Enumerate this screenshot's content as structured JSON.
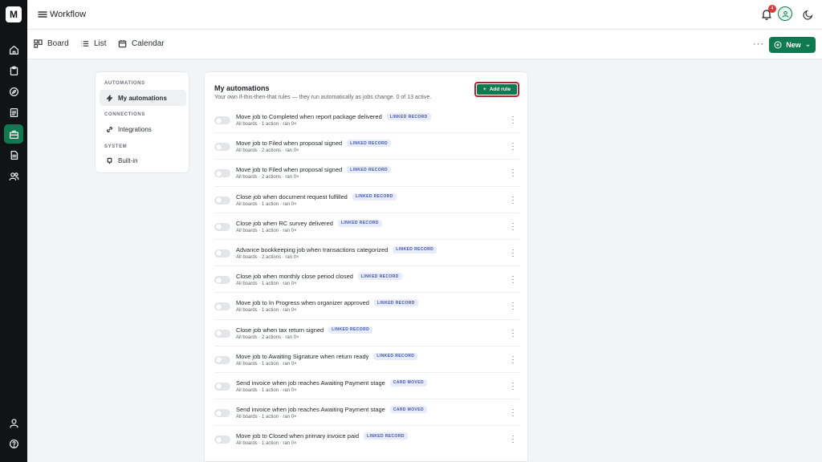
{
  "rail": {
    "logo": "M",
    "items": [
      "home",
      "clipboard",
      "compass",
      "document",
      "briefcase",
      "file",
      "users"
    ],
    "bottom": [
      "user",
      "help"
    ]
  },
  "topbar": {
    "title": "Workflow",
    "notifications": "4"
  },
  "viewbar": {
    "tabs": [
      {
        "label": "Board",
        "icon": "board-icon"
      },
      {
        "label": "List",
        "icon": "list-icon"
      },
      {
        "label": "Calendar",
        "icon": "calendar-icon"
      }
    ],
    "more": "···",
    "new_label": "New"
  },
  "sidenav": {
    "automations_heading": "AUTOMATIONS",
    "my_automations": "My automations",
    "connections_heading": "CONNECTIONS",
    "integrations": "Integrations",
    "system_heading": "SYSTEM",
    "builtin": "Built-in"
  },
  "main": {
    "title": "My automations",
    "subtitle": "Your own if-this-then-that rules — they run automatically as jobs change. 0 of 13 active.",
    "add_rule": "Add rule",
    "rules": [
      {
        "name": "Move job to Completed when report package delivered",
        "tag": "LINKED RECORD",
        "meta": "All boards · 1 action · ran 0×"
      },
      {
        "name": "Move job to Filed when proposal signed",
        "tag": "LINKED RECORD",
        "meta": "All boards · 2 actions · ran 0×"
      },
      {
        "name": "Move job to Filed when proposal signed",
        "tag": "LINKED RECORD",
        "meta": "All boards · 2 actions · ran 0×"
      },
      {
        "name": "Close job when document request fulfilled",
        "tag": "LINKED RECORD",
        "meta": "All boards · 1 action · ran 0×"
      },
      {
        "name": "Close job when RC survey delivered",
        "tag": "LINKED RECORD",
        "meta": "All boards · 1 action · ran 0×"
      },
      {
        "name": "Advance bookkeeping job when transactions categorized",
        "tag": "LINKED RECORD",
        "meta": "All boards · 2 actions · ran 0×"
      },
      {
        "name": "Close job when monthly close period closed",
        "tag": "LINKED RECORD",
        "meta": "All boards · 1 action · ran 0×"
      },
      {
        "name": "Move job to In Progress when organizer approved",
        "tag": "LINKED RECORD",
        "meta": "All boards · 1 action · ran 0×"
      },
      {
        "name": "Close job when tax return signed",
        "tag": "LINKED RECORD",
        "meta": "All boards · 2 actions · ran 0×"
      },
      {
        "name": "Move job to Awaiting Signature when return ready",
        "tag": "LINKED RECORD",
        "meta": "All boards · 1 action · ran 0×"
      },
      {
        "name": "Send invoice when job reaches Awaiting Payment stage",
        "tag": "CARD MOVED",
        "meta": "All boards · 1 action · ran 0×"
      },
      {
        "name": "Send invoice when job reaches Awaiting Payment stage",
        "tag": "CARD MOVED",
        "meta": "All boards · 1 action · ran 0×"
      },
      {
        "name": "Move job to Closed when primary invoice paid",
        "tag": "LINKED RECORD",
        "meta": "All boards · 1 action · ran 0×"
      }
    ]
  },
  "colors": {
    "accent": "#0f7a4f",
    "highlight": "#b4232f",
    "tag_text": "#3f56b3",
    "tag_bg": "#e8ecfa"
  }
}
